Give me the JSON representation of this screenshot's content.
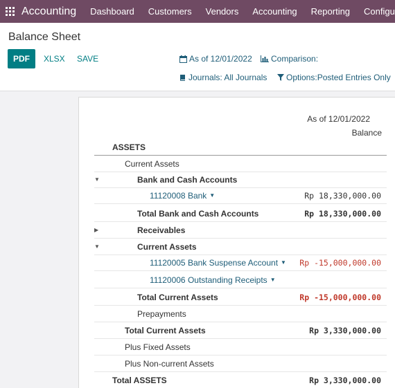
{
  "navbar": {
    "app_title": "Accounting",
    "menu": [
      "Dashboard",
      "Customers",
      "Vendors",
      "Accounting",
      "Reporting",
      "Configuration"
    ]
  },
  "control_panel": {
    "title": "Balance Sheet",
    "buttons": {
      "pdf": "PDF",
      "xlsx": "XLSX",
      "save": "SAVE"
    },
    "filters": {
      "date": "As of 12/01/2022",
      "comparison": "Comparison:",
      "journals": "Journals: All Journals",
      "options": "Options:Posted Entries Only"
    }
  },
  "report": {
    "header_date": "As of 12/01/2022",
    "header_col": "Balance",
    "rows": [
      {
        "label": "ASSETS",
        "amount": ""
      },
      {
        "label": "Current Assets",
        "amount": ""
      },
      {
        "label": "Bank and Cash Accounts",
        "amount": ""
      },
      {
        "label": "11120008 Bank",
        "amount": "Rp 18,330,000.00"
      },
      {
        "label": "Total Bank and Cash Accounts",
        "amount": "Rp 18,330,000.00"
      },
      {
        "label": "Receivables",
        "amount": ""
      },
      {
        "label": "Current Assets",
        "amount": ""
      },
      {
        "label": "11120005 Bank Suspense Account",
        "amount": "Rp -15,000,000.00"
      },
      {
        "label": "11120006 Outstanding Receipts",
        "amount": ""
      },
      {
        "label": "Total Current Assets",
        "amount": "Rp -15,000,000.00"
      },
      {
        "label": "Prepayments",
        "amount": ""
      },
      {
        "label": "Total Current Assets",
        "amount": "Rp 3,330,000.00"
      },
      {
        "label": "Plus Fixed Assets",
        "amount": ""
      },
      {
        "label": "Plus Non-current Assets",
        "amount": ""
      },
      {
        "label": "Total ASSETS",
        "amount": "Rp 3,330,000.00"
      }
    ]
  }
}
